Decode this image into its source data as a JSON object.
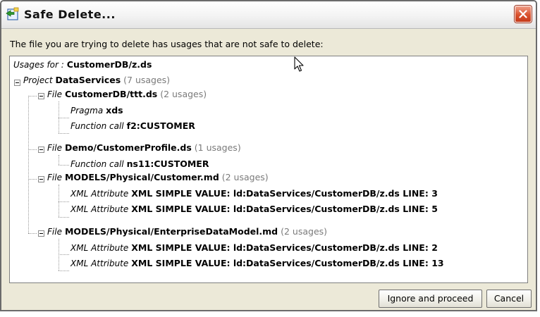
{
  "window": {
    "title": "Safe Delete...",
    "message": "The file you are trying to delete has usages that are not safe to delete:"
  },
  "tree": {
    "header": {
      "prefix": "Usages for :",
      "target": "CustomerDB/z.ds"
    },
    "project": {
      "kind": "Project",
      "name": "DataServices",
      "count": "(7 usages)"
    },
    "files": [
      {
        "kind": "File",
        "name": "CustomerDB/ttt.ds",
        "count": "(2 usages)",
        "usages": [
          {
            "kind": "Pragma",
            "value": "xds"
          },
          {
            "kind": "Function call",
            "value": "f2:CUSTOMER"
          }
        ]
      },
      {
        "kind": "File",
        "name": "Demo/CustomerProfile.ds",
        "count": "(1 usages)",
        "usages": [
          {
            "kind": "Function call",
            "value": "ns11:CUSTOMER"
          }
        ]
      },
      {
        "kind": "File",
        "name": "MODELS/Physical/Customer.md",
        "count": "(2 usages)",
        "usages": [
          {
            "kind": "XML Attribute",
            "value": "XML SIMPLE VALUE: ld:DataServices/CustomerDB/z.ds LINE: 3"
          },
          {
            "kind": "XML Attribute",
            "value": "XML SIMPLE VALUE: ld:DataServices/CustomerDB/z.ds LINE: 5"
          }
        ]
      },
      {
        "kind": "File",
        "name": "MODELS/Physical/EnterpriseDataModel.md",
        "count": "(2 usages)",
        "usages": [
          {
            "kind": "XML Attribute",
            "value": "XML SIMPLE VALUE: ld:DataServices/CustomerDB/z.ds LINE: 2"
          },
          {
            "kind": "XML Attribute",
            "value": "XML SIMPLE VALUE: ld:DataServices/CustomerDB/z.ds LINE: 13"
          }
        ]
      }
    ]
  },
  "buttons": {
    "proceed": "Ignore and proceed",
    "cancel": "Cancel"
  },
  "icons": {
    "title": "safe-delete-icon",
    "close": "close-icon",
    "cursor": "mouse-pointer-icon"
  },
  "colors": {
    "close_button": "#d9512d",
    "muted_text": "#7a7a7a",
    "dialog_bg": "#ece9d8"
  }
}
